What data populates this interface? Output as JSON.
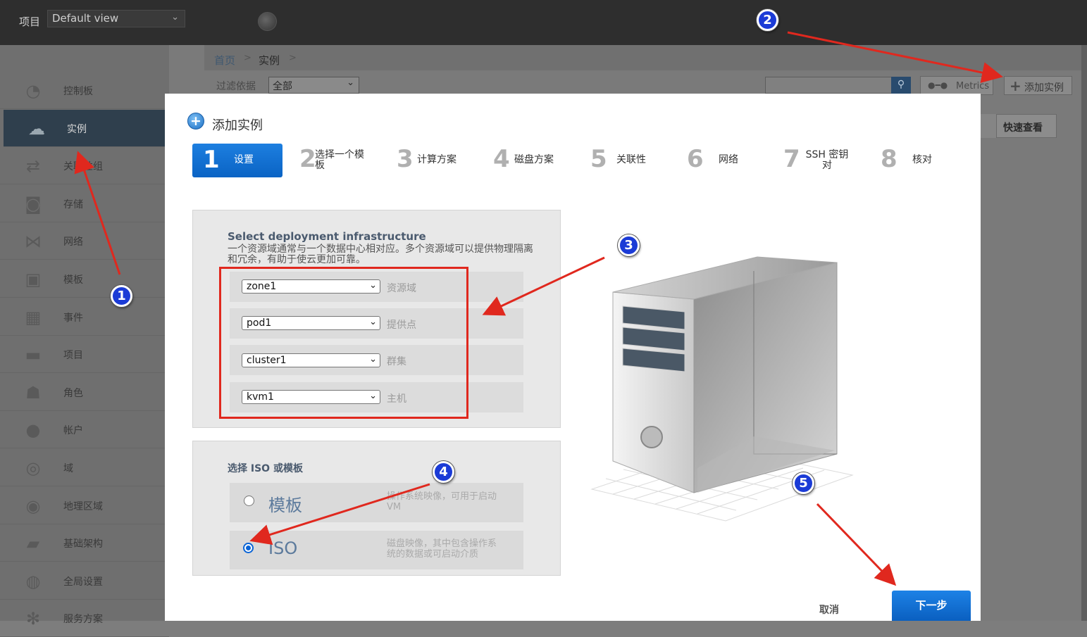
{
  "header": {
    "project_label": "项目",
    "project_view": "Default view",
    "chevron_icon": "chevron-down-icon",
    "globe_icon": "globe-icon"
  },
  "sidebar": {
    "items": [
      {
        "label": "控制板",
        "icon": "dashboard-icon"
      },
      {
        "label": "实例",
        "icon": "cloud-icon"
      },
      {
        "label": "关联性组",
        "icon": "affinity-icon"
      },
      {
        "label": "存储",
        "icon": "disk-icon"
      },
      {
        "label": "网络",
        "icon": "network-icon"
      },
      {
        "label": "模板",
        "icon": "template-icon"
      },
      {
        "label": "事件",
        "icon": "calendar-icon"
      },
      {
        "label": "项目",
        "icon": "folder-icon"
      },
      {
        "label": "角色",
        "icon": "roles-icon"
      },
      {
        "label": "帐户",
        "icon": "user-icon"
      },
      {
        "label": "域",
        "icon": "domain-icon"
      },
      {
        "label": "地理区域",
        "icon": "earth-icon"
      },
      {
        "label": "基础架构",
        "icon": "infrastructure-icon"
      },
      {
        "label": "全局设置",
        "icon": "settings-globe-icon"
      },
      {
        "label": "服务方案",
        "icon": "gear-icon"
      }
    ]
  },
  "breadcrumb": {
    "home": "首页",
    "current": "实例",
    "sep": ">"
  },
  "toolbar": {
    "filter_label": "过滤依据",
    "filter_value": "全部",
    "metrics_label": "Metrics",
    "add_instance_label": "添加实例",
    "quick_view_label": "快速查看"
  },
  "dialog": {
    "title": "添加实例",
    "steps": [
      {
        "num": "1",
        "label": "设置"
      },
      {
        "num": "2",
        "label": "选择一个模板"
      },
      {
        "num": "3",
        "label": "计算方案"
      },
      {
        "num": "4",
        "label": "磁盘方案"
      },
      {
        "num": "5",
        "label": "关联性"
      },
      {
        "num": "6",
        "label": "网络"
      },
      {
        "num": "7",
        "label": "SSH 密钥对"
      },
      {
        "num": "8",
        "label": "核对"
      }
    ],
    "infra": {
      "title": "Select deployment infrastructure",
      "desc_line1": "一个资源域通常与一个数据中心相对应。多个资源域可以提供物理隔离",
      "desc_line2": "和冗余，有助于使云更加可靠。",
      "rows": [
        {
          "value": "zone1",
          "label": "资源域"
        },
        {
          "value": "pod1",
          "label": "提供点"
        },
        {
          "value": "cluster1",
          "label": "群集"
        },
        {
          "value": "kvm1",
          "label": "主机"
        }
      ]
    },
    "iso": {
      "title": "选择 ISO 或模板",
      "options": [
        {
          "label": "模板",
          "desc1": "操作系统映像，可用于启动",
          "desc2": "VM",
          "selected": false
        },
        {
          "label": "ISO",
          "desc1": "磁盘映像，其中包含操作系",
          "desc2": "统的数据或可启动介质",
          "selected": true
        }
      ]
    },
    "cancel_label": "取消",
    "next_label": "下一步"
  },
  "annotations": {
    "markers": [
      "1",
      "2",
      "3",
      "4",
      "5"
    ],
    "arrow_color": "#e0281e",
    "marker_color": "#1b3bd6"
  }
}
